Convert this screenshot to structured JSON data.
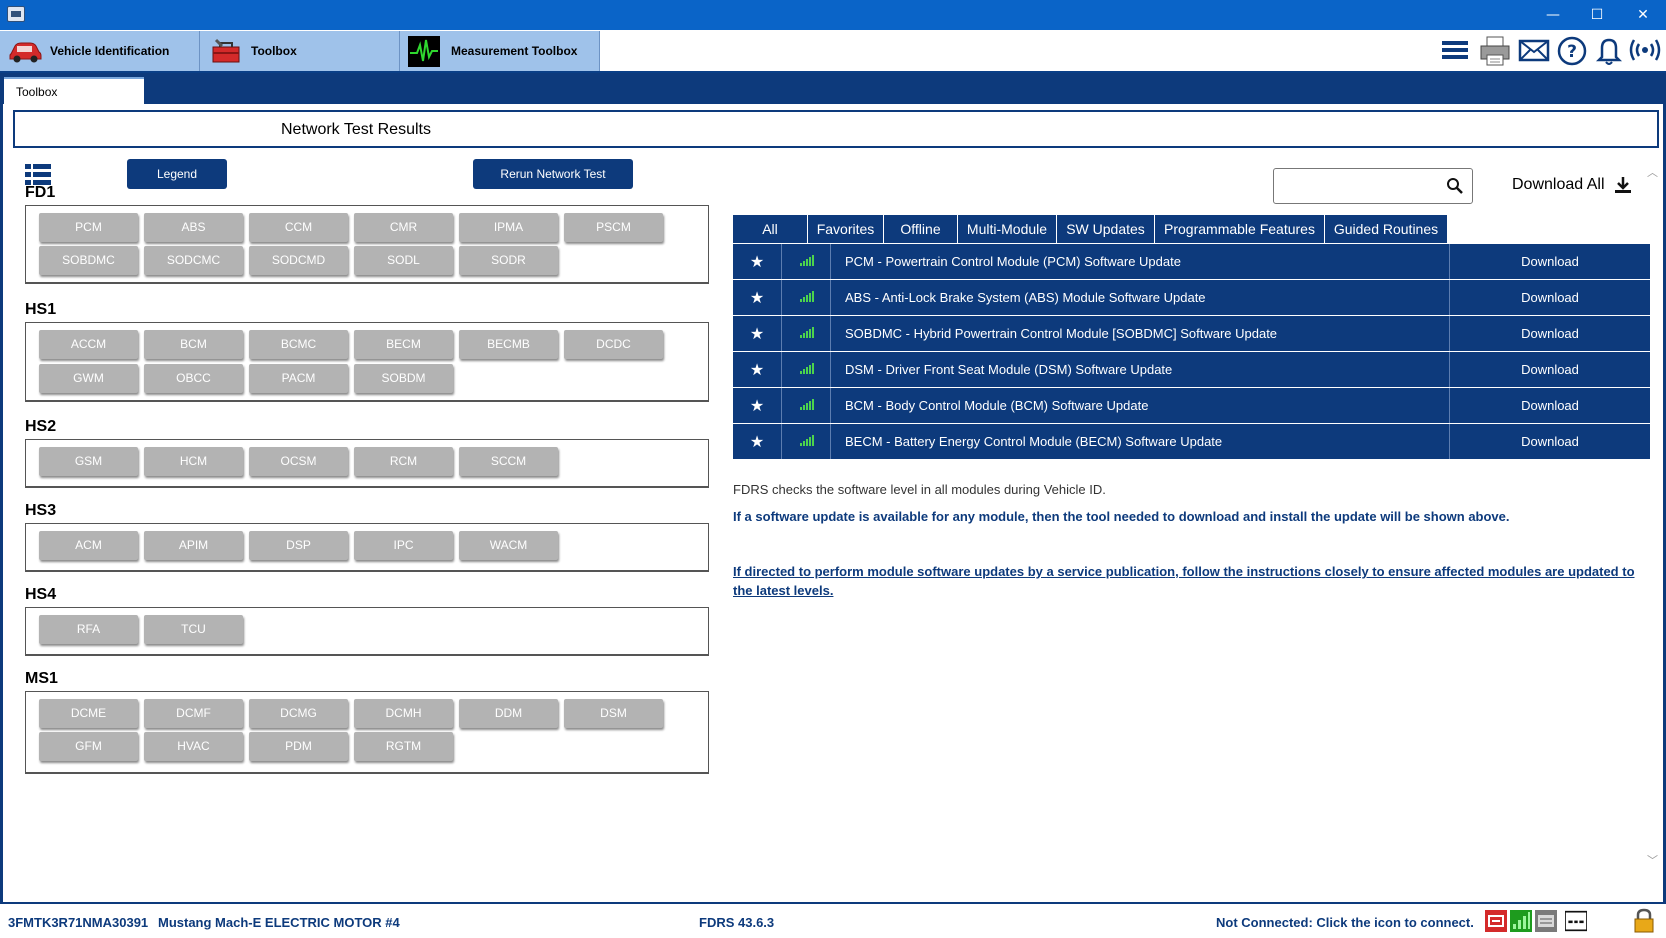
{
  "window": {
    "minimize": "—",
    "maximize": "☐",
    "close": "✕"
  },
  "main_tabs": [
    {
      "label": "Vehicle Identification",
      "icon": "car-icon"
    },
    {
      "label": "Toolbox",
      "icon": "toolbox-icon"
    },
    {
      "label": "Measurement Toolbox",
      "icon": "oscilloscope-icon"
    }
  ],
  "toolbar_icons": [
    "menu-icon",
    "printer-icon",
    "mail-icon",
    "help-icon",
    "bell-icon",
    "wireless-icon"
  ],
  "sub_tab": "Toolbox",
  "results_title": "Network Test Results",
  "buttons": {
    "legend": "Legend",
    "rerun": "Rerun Network Test"
  },
  "buses": [
    {
      "name": "FD1",
      "modules": [
        "PCM",
        "ABS",
        "CCM",
        "CMR",
        "IPMA",
        "PSCM",
        "SOBDMC",
        "SODCMC",
        "SODCMD",
        "SODL",
        "SODR"
      ]
    },
    {
      "name": "HS1",
      "modules": [
        "ACCM",
        "BCM",
        "BCMC",
        "BECM",
        "BECMB",
        "DCDC",
        "GWM",
        "OBCC",
        "PACM",
        "SOBDM"
      ]
    },
    {
      "name": "HS2",
      "modules": [
        "GSM",
        "HCM",
        "OCSM",
        "RCM",
        "SCCM"
      ]
    },
    {
      "name": "HS3",
      "modules": [
        "ACM",
        "APIM",
        "DSP",
        "IPC",
        "WACM"
      ]
    },
    {
      "name": "HS4",
      "modules": [
        "RFA",
        "TCU"
      ]
    },
    {
      "name": "MS1",
      "modules": [
        "DCME",
        "DCMF",
        "DCMG",
        "DCMH",
        "DDM",
        "DSM",
        "GFM",
        "HVAC",
        "PDM",
        "RGTM"
      ]
    }
  ],
  "search": {
    "value": "",
    "placeholder": ""
  },
  "download_all": "Download All",
  "filter_tabs": [
    "All",
    "Favorites",
    "Offline",
    "Multi-Module",
    "SW Updates",
    "Programmable Features",
    "Guided Routines"
  ],
  "updates": [
    {
      "desc": "PCM - Powertrain Control Module (PCM) Software Update",
      "action": "Download"
    },
    {
      "desc": "ABS - Anti-Lock Brake System (ABS) Module Software Update",
      "action": "Download"
    },
    {
      "desc": "SOBDMC - Hybrid Powertrain Control Module [SOBDMC] Software Update",
      "action": "Download"
    },
    {
      "desc": "DSM - Driver Front Seat Module (DSM) Software Update",
      "action": "Download"
    },
    {
      "desc": "BCM - Body Control Module (BCM) Software Update",
      "action": "Download"
    },
    {
      "desc": "BECM - Battery Energy Control Module (BECM) Software Update",
      "action": "Download"
    }
  ],
  "info": {
    "line1": "FDRS checks the software level in all modules during Vehicle ID.",
    "line2": "If a software update is available for any module, then the tool needed to download and install the update will be shown above.",
    "line3": "If directed to perform module software updates by a service publication, follow the instructions closely to ensure affected modules are updated to the latest levels."
  },
  "status": {
    "vin": "3FMTK3R71NMA30391",
    "vehicle": "Mustang Mach-E ELECTRIC MOTOR #4",
    "version": "FDRS 43.6.3",
    "connection": "Not Connected: Click the icon to connect."
  },
  "colors": {
    "titlebar": "#0a64c8",
    "navy": "#0d3a7c",
    "tab_blue": "#9fc2ea",
    "module_gray": "#b3b3b3",
    "signal_green": "#4cd44c"
  }
}
